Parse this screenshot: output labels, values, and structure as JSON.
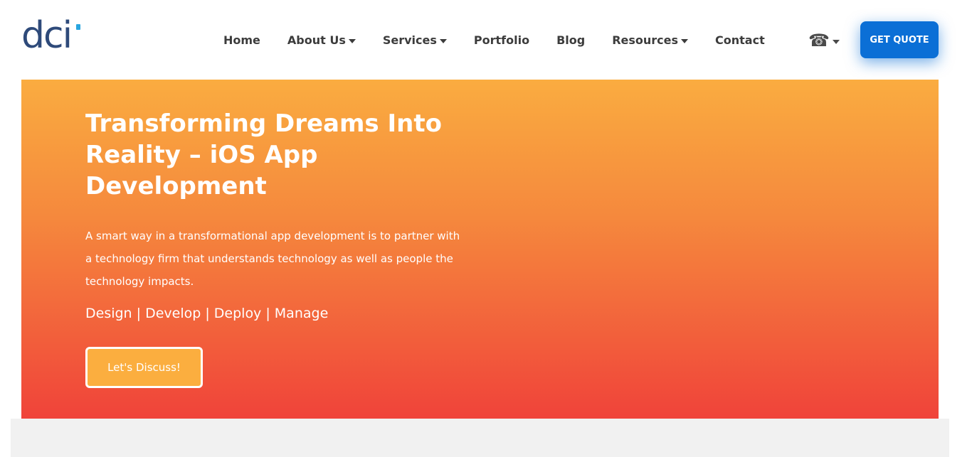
{
  "logo": {
    "text": "dci",
    "accent_color": "#29a6e0",
    "text_color": "#2e4a7a"
  },
  "nav": {
    "items": [
      {
        "label": "Home",
        "dropdown": false
      },
      {
        "label": "About Us",
        "dropdown": true
      },
      {
        "label": "Services",
        "dropdown": true
      },
      {
        "label": "Portfolio",
        "dropdown": false
      },
      {
        "label": "Blog",
        "dropdown": false
      },
      {
        "label": "Resources",
        "dropdown": true
      },
      {
        "label": "Contact",
        "dropdown": false
      }
    ]
  },
  "header": {
    "phone_icon": "phone-icon",
    "quote_button": "GET QUOTE",
    "quote_color": "#0b6fd6"
  },
  "hero": {
    "title": "Transforming Dreams Into Reality – iOS App Development",
    "description": "A smart way in a transformational app development is to partner with a technology firm that understands technology as well as people the technology impacts.",
    "tagline": "Design | Develop | Deploy | Manage",
    "cta": "Let's Discuss!",
    "gradient_top": "#faac40",
    "gradient_bottom": "#f0433a"
  }
}
